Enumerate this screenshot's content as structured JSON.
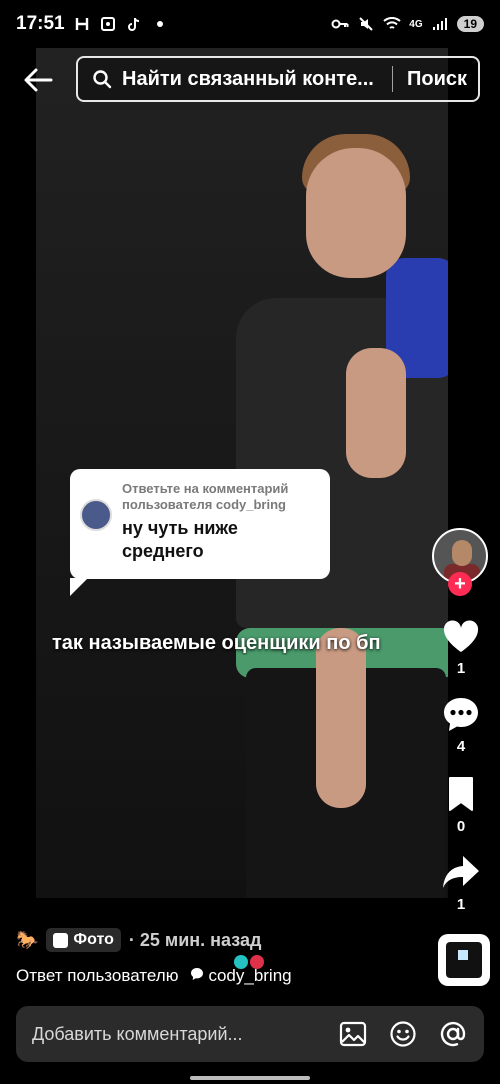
{
  "status_bar": {
    "time": "17:51",
    "battery": "19",
    "network": "4G"
  },
  "search": {
    "placeholder": "Найти связанный конте...",
    "button": "Поиск"
  },
  "reply_card": {
    "header": "Ответьте на комментарий пользователя cody_bring",
    "text": "ну чуть ниже среднего"
  },
  "overlay_caption": "так называемые оценщики по бп",
  "actions": {
    "likes": "1",
    "comments": "4",
    "saves": "0",
    "shares": "1"
  },
  "meta": {
    "emoji": "🐎",
    "photo_label": "Фото",
    "time_ago": "· 25 мин. назад",
    "reply_prefix": "Ответ пользователю",
    "reply_user": "cody_bring"
  },
  "comment_input": {
    "placeholder": "Добавить комментарий..."
  },
  "colors": {
    "accent": "#fe2c55",
    "dot_teal": "#25c2c2",
    "dot_red": "#e0314a"
  }
}
